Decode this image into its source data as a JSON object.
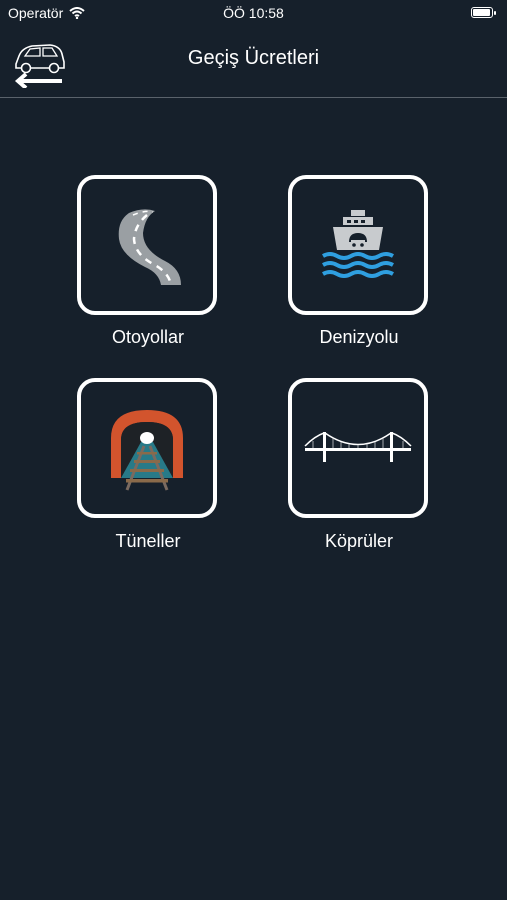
{
  "status_bar": {
    "carrier": "Operatör",
    "time": "ÖÖ 10:58"
  },
  "nav": {
    "title": "Geçiş Ücretleri"
  },
  "categories": [
    {
      "label": "Otoyollar",
      "icon": "highway-road-icon"
    },
    {
      "label": "Denizyolu",
      "icon": "ferry-ship-icon"
    },
    {
      "label": "Tüneller",
      "icon": "tunnel-railway-icon"
    },
    {
      "label": "Köprüler",
      "icon": "suspension-bridge-icon"
    }
  ],
  "colors": {
    "background": "#16202b",
    "tile_border": "#ffffff",
    "tunnel_orange": "#d2542d",
    "water_blue": "#2f9fe0"
  }
}
